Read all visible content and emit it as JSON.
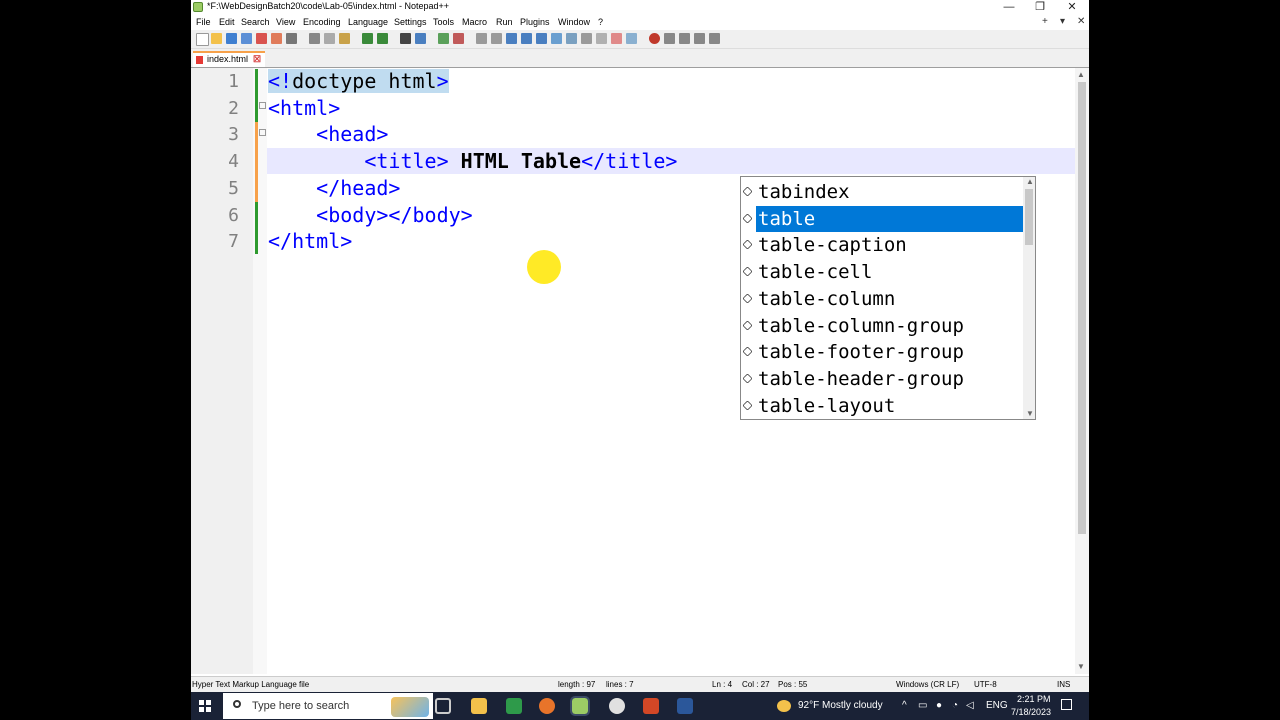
{
  "window": {
    "title": "*F:\\WebDesignBatch20\\code\\Lab-05\\index.html - Notepad++",
    "controls": {
      "minimize": "—",
      "restore": "❐",
      "close": "✕"
    }
  },
  "menu": {
    "items": [
      "File",
      "Edit",
      "Search",
      "View",
      "Encoding",
      "Language",
      "Settings",
      "Tools",
      "Macro",
      "Run",
      "Plugins",
      "Window",
      "?"
    ],
    "right": [
      "+",
      "▾",
      "✕"
    ]
  },
  "tab": {
    "label": "index.html",
    "close": "☒"
  },
  "lines": [
    {
      "num": "1",
      "parts": [
        {
          "t": "<!",
          "c": "tag hl"
        },
        {
          "t": "doctype html",
          "c": "hl"
        },
        {
          "t": ">",
          "c": "tag hl"
        }
      ]
    },
    {
      "num": "2",
      "parts": [
        {
          "t": "<html>",
          "c": "tag"
        }
      ]
    },
    {
      "num": "3",
      "parts": [
        {
          "t": "    <head>",
          "c": "tag"
        }
      ]
    },
    {
      "num": "4",
      "parts": [
        {
          "t": "        <title>",
          "c": "tag"
        },
        {
          "t": " HTML Table",
          "c": "bold"
        },
        {
          "t": "</title>",
          "c": "tag"
        }
      ]
    },
    {
      "num": "5",
      "parts": [
        {
          "t": "    </head>",
          "c": "tag"
        }
      ]
    },
    {
      "num": "6",
      "parts": [
        {
          "t": "    <body></body>",
          "c": "tag"
        }
      ]
    },
    {
      "num": "7",
      "parts": [
        {
          "t": "</html>",
          "c": "tag"
        }
      ]
    }
  ],
  "autocomplete": {
    "items": [
      "tabindex",
      "table",
      "table-caption",
      "table-cell",
      "table-column",
      "table-column-group",
      "table-footer-group",
      "table-header-group",
      "table-layout"
    ],
    "selected": 1
  },
  "status": {
    "filetype": "Hyper Text Markup Language file",
    "length": "length : 97",
    "lines": "lines : 7",
    "ln": "Ln : 4",
    "col": "Col : 27",
    "pos": "Pos : 55",
    "eol": "Windows (CR LF)",
    "encoding": "UTF-8",
    "mode": "INS"
  },
  "taskbar": {
    "search_placeholder": "Type here to search",
    "weather": "92°F  Mostly cloudy",
    "lang": "ENG",
    "time": "2:21 PM",
    "date": "7/18/2023"
  }
}
